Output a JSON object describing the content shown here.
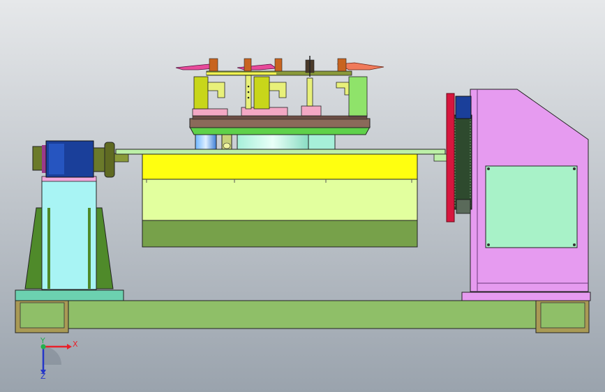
{
  "viewport": {
    "background_top": "#e6e8ea",
    "background_bottom": "#9aa3ad"
  },
  "triad": {
    "x_label": "X",
    "y_label": "Y",
    "z_label": "Z",
    "x_color": "#e8202a",
    "y_color": "#22b14c",
    "z_color": "#2536c8"
  },
  "colors": {
    "base_rail": "#8fbf68",
    "base_feet": "#a99a55",
    "left_column": "#a8f4f4",
    "left_gussets": "#4f8a2a",
    "motor": "#1a3f9a",
    "flange": "#6b7a2a",
    "yellow_beam": "#ffff10",
    "table_light": "#e2ff9e",
    "table_dark": "#77a14a",
    "right_housing": "#e69bf0",
    "right_panel": "#a8f2c8",
    "gear_red": "#d6163e",
    "fixture_green": "#8fe36a",
    "top_plate": "#bdf0a8"
  }
}
